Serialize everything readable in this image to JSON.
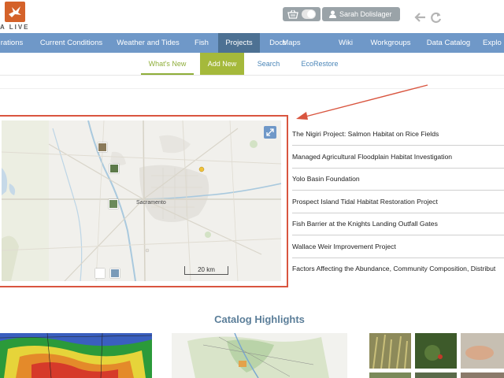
{
  "header": {
    "logo_text": "A LIVE",
    "user_name": "Sarah Dolislager",
    "icons": [
      "bird-logo-icon",
      "basket-icon",
      "user-icon",
      "back-arrow-icon",
      "refresh-icon"
    ]
  },
  "main_nav": {
    "items": [
      "rations",
      "Current Conditions",
      "Weather and Tides",
      "Fish",
      "Projects",
      "Docs",
      "Maps",
      "Wiki",
      "Workgroups",
      "Data Catalog",
      "Explo"
    ],
    "active": "Projects",
    "color": "#6f98c8",
    "active_color": "#4d7193"
  },
  "sub_nav": {
    "items": [
      "What's New",
      "Add New",
      "Search",
      "EcoRestore"
    ],
    "active": "What's New"
  },
  "map": {
    "scale_label": "20 km",
    "cities": [
      "Sacramento"
    ],
    "icons": [
      "expand-icon"
    ]
  },
  "projects": [
    "The Nigiri Project: Salmon Habitat on Rice Fields",
    "Managed Agricultural Floodplain Habitat Investigation",
    "Yolo Basin Foundation",
    "Prospect Island Tidal Habitat Restoration Project",
    "Fish Barrier at the Knights Landing Outfall Gates",
    "Wallace Weir Improvement Project",
    "Factors Affecting the Abundance, Community Composition, Distribut"
  ],
  "catalog": {
    "title": "Catalog Highlights"
  },
  "colors": {
    "accent_orange": "#d4622a",
    "highlight_red": "#d9553f",
    "green": "#a5b93b"
  }
}
